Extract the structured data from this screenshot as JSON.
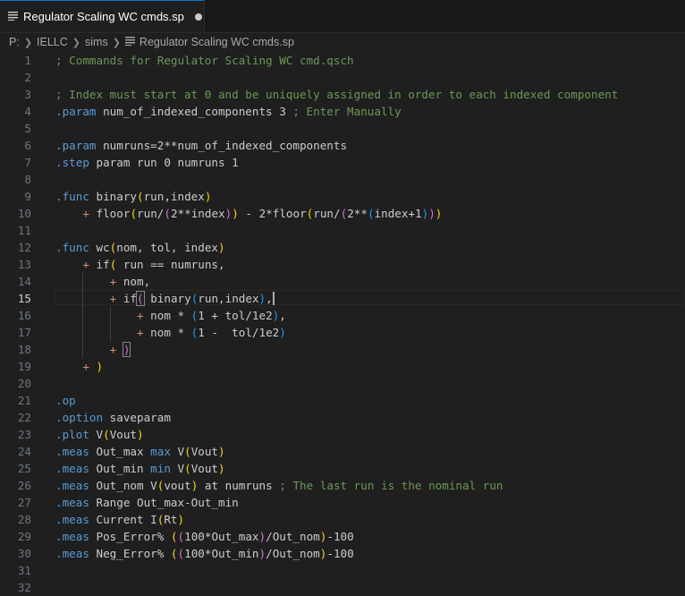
{
  "tab": {
    "title": "Regulator Scaling WC cmds.sp",
    "icon": "file-lines-icon",
    "modified": true
  },
  "breadcrumb": [
    "P:",
    "IELLC",
    "sims",
    "Regulator Scaling WC cmds.sp"
  ],
  "editor": {
    "active_line": 15,
    "lines": [
      {
        "n": "1",
        "t": [
          [
            "c",
            "; Commands for Regulator Scaling WC cmd.qsch"
          ]
        ]
      },
      {
        "n": "2",
        "t": []
      },
      {
        "n": "3",
        "t": [
          [
            "c",
            "; Index must start at 0 and be uniquely assigned in order to each indexed component"
          ]
        ]
      },
      {
        "n": "4",
        "t": [
          [
            "k",
            ".param"
          ],
          [
            "p",
            " num_of_indexed_components 3 "
          ],
          [
            "c",
            "; Enter Manually"
          ]
        ]
      },
      {
        "n": "5",
        "t": []
      },
      {
        "n": "6",
        "t": [
          [
            "k",
            ".param"
          ],
          [
            "p",
            " numruns=2**num_of_indexed_components"
          ]
        ]
      },
      {
        "n": "7",
        "t": [
          [
            "k",
            ".step"
          ],
          [
            "p",
            " param run 0 numruns 1"
          ]
        ]
      },
      {
        "n": "8",
        "t": []
      },
      {
        "n": "9",
        "t": [
          [
            "k",
            ".func"
          ],
          [
            "p",
            " binary"
          ],
          [
            "y",
            "("
          ],
          [
            "p",
            "run,index"
          ],
          [
            "y",
            ")"
          ]
        ]
      },
      {
        "n": "10",
        "t": [
          [
            "p",
            "    "
          ],
          [
            "o",
            "+"
          ],
          [
            "p",
            " floor"
          ],
          [
            "y",
            "("
          ],
          [
            "p",
            "run/"
          ],
          [
            "m",
            "("
          ],
          [
            "p",
            "2**index"
          ],
          [
            "m",
            ")"
          ],
          [
            "y",
            ")"
          ],
          [
            "p",
            " - 2*floor"
          ],
          [
            "y",
            "("
          ],
          [
            "p",
            "run/"
          ],
          [
            "m",
            "("
          ],
          [
            "p",
            "2**"
          ],
          [
            "b",
            "("
          ],
          [
            "p",
            "index+1"
          ],
          [
            "b",
            ")"
          ],
          [
            "m",
            ")"
          ],
          [
            "y",
            ")"
          ]
        ]
      },
      {
        "n": "11",
        "t": []
      },
      {
        "n": "12",
        "t": [
          [
            "k",
            ".func"
          ],
          [
            "p",
            " wc"
          ],
          [
            "y",
            "("
          ],
          [
            "p",
            "nom, tol, index"
          ],
          [
            "y",
            ")"
          ]
        ]
      },
      {
        "n": "13",
        "t": [
          [
            "p",
            "    "
          ],
          [
            "o",
            "+"
          ],
          [
            "p",
            " if"
          ],
          [
            "y",
            "("
          ],
          [
            "p",
            " run == numruns,"
          ]
        ]
      },
      {
        "n": "14",
        "t": [
          [
            "p",
            "        "
          ],
          [
            "o",
            "+"
          ],
          [
            "p",
            " nom,"
          ]
        ]
      },
      {
        "n": "15",
        "t": [
          [
            "p",
            "        "
          ],
          [
            "o",
            "+"
          ],
          [
            "p",
            " if"
          ],
          [
            "mb",
            "("
          ],
          [
            "p",
            " binary"
          ],
          [
            "b",
            "("
          ],
          [
            "p",
            "run,index"
          ],
          [
            "b",
            ")"
          ],
          [
            "p",
            ","
          ]
        ]
      },
      {
        "n": "16",
        "t": [
          [
            "p",
            "            "
          ],
          [
            "o",
            "+"
          ],
          [
            "p",
            " nom * "
          ],
          [
            "b",
            "("
          ],
          [
            "p",
            "1 + tol/1e2"
          ],
          [
            "b",
            ")"
          ],
          [
            "p",
            ","
          ]
        ]
      },
      {
        "n": "17",
        "t": [
          [
            "p",
            "            "
          ],
          [
            "o",
            "+"
          ],
          [
            "p",
            " nom * "
          ],
          [
            "b",
            "("
          ],
          [
            "p",
            "1 -  tol/1e2"
          ],
          [
            "b",
            ")"
          ]
        ]
      },
      {
        "n": "18",
        "t": [
          [
            "p",
            "        "
          ],
          [
            "o",
            "+"
          ],
          [
            "p",
            " "
          ],
          [
            "mb",
            ")"
          ]
        ]
      },
      {
        "n": "19",
        "t": [
          [
            "p",
            "    "
          ],
          [
            "o",
            "+"
          ],
          [
            "p",
            " "
          ],
          [
            "y",
            ")"
          ]
        ]
      },
      {
        "n": "20",
        "t": []
      },
      {
        "n": "21",
        "t": [
          [
            "k",
            ".op"
          ]
        ]
      },
      {
        "n": "22",
        "t": [
          [
            "k",
            ".option"
          ],
          [
            "p",
            " saveparam"
          ]
        ]
      },
      {
        "n": "23",
        "t": [
          [
            "k",
            ".plot"
          ],
          [
            "p",
            " V"
          ],
          [
            "y",
            "("
          ],
          [
            "p",
            "Vout"
          ],
          [
            "y",
            ")"
          ]
        ]
      },
      {
        "n": "24",
        "t": [
          [
            "k",
            ".meas"
          ],
          [
            "p",
            " Out_max "
          ],
          [
            "k",
            "max"
          ],
          [
            "p",
            " V"
          ],
          [
            "y",
            "("
          ],
          [
            "p",
            "Vout"
          ],
          [
            "y",
            ")"
          ]
        ]
      },
      {
        "n": "25",
        "t": [
          [
            "k",
            ".meas"
          ],
          [
            "p",
            " Out_min "
          ],
          [
            "k",
            "min"
          ],
          [
            "p",
            " V"
          ],
          [
            "y",
            "("
          ],
          [
            "p",
            "Vout"
          ],
          [
            "y",
            ")"
          ]
        ]
      },
      {
        "n": "26",
        "t": [
          [
            "k",
            ".meas"
          ],
          [
            "p",
            " Out_nom V"
          ],
          [
            "y",
            "("
          ],
          [
            "p",
            "vout"
          ],
          [
            "y",
            ")"
          ],
          [
            "p",
            " at numruns "
          ],
          [
            "c",
            "; The last run is the nominal run"
          ]
        ]
      },
      {
        "n": "27",
        "t": [
          [
            "k",
            ".meas"
          ],
          [
            "p",
            " Range Out_max-Out_min"
          ]
        ]
      },
      {
        "n": "28",
        "t": [
          [
            "k",
            ".meas"
          ],
          [
            "p",
            " Current I"
          ],
          [
            "y",
            "("
          ],
          [
            "p",
            "Rt"
          ],
          [
            "y",
            ")"
          ]
        ]
      },
      {
        "n": "29",
        "t": [
          [
            "k",
            ".meas"
          ],
          [
            "p",
            " Pos_Error% "
          ],
          [
            "y",
            "("
          ],
          [
            "m",
            "("
          ],
          [
            "p",
            "100*Out_max"
          ],
          [
            "m",
            ")"
          ],
          [
            "p",
            "/Out_nom"
          ],
          [
            "y",
            ")"
          ],
          [
            "p",
            "-100"
          ]
        ]
      },
      {
        "n": "30",
        "t": [
          [
            "k",
            ".meas"
          ],
          [
            "p",
            " Neg_Error% "
          ],
          [
            "y",
            "("
          ],
          [
            "m",
            "("
          ],
          [
            "p",
            "100*Out_min"
          ],
          [
            "m",
            ")"
          ],
          [
            "p",
            "/Out_nom"
          ],
          [
            "y",
            ")"
          ],
          [
            "p",
            "-100"
          ]
        ]
      },
      {
        "n": "31",
        "t": []
      },
      {
        "n": "32",
        "t": []
      }
    ]
  }
}
